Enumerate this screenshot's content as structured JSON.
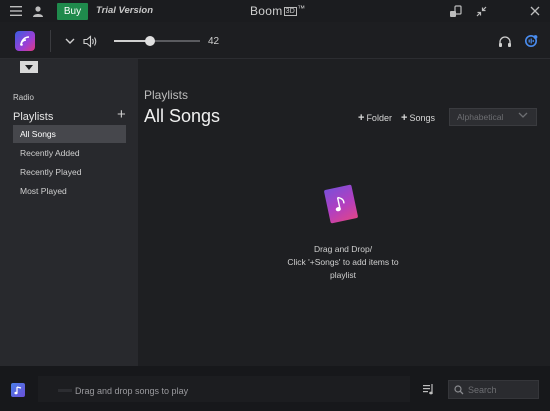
{
  "titlebar": {
    "buy_label": "Buy",
    "trial_label": "Trial Version",
    "app_name": "Boom",
    "app_suffix": "3D",
    "app_tm": "™"
  },
  "toolbar": {
    "volume_value": "42",
    "volume_level": 0.42
  },
  "sidebar": {
    "radio_label": "Radio",
    "playlists_heading": "Playlists",
    "items": [
      {
        "label": "All Songs",
        "active": true
      },
      {
        "label": "Recently Added",
        "active": false
      },
      {
        "label": "Recently Played",
        "active": false
      },
      {
        "label": "Most Played",
        "active": false
      }
    ]
  },
  "main": {
    "breadcrumb": "Playlists",
    "title": "All Songs",
    "folder_label": "Folder",
    "songs_label": "Songs",
    "sort_selected": "Alphabetical",
    "empty_line1": "Drag and Drop/",
    "empty_line2": "Click '+Songs' to add items to",
    "empty_line3": "playlist"
  },
  "bottombar": {
    "now_playing_text": "Drag and drop songs to play",
    "search_placeholder": "Search"
  },
  "colors": {
    "buy_green": "#1f8a4c",
    "accent_blue": "#4a8df0",
    "sidebar_bg": "#28292d",
    "main_bg": "#1e1f22"
  }
}
